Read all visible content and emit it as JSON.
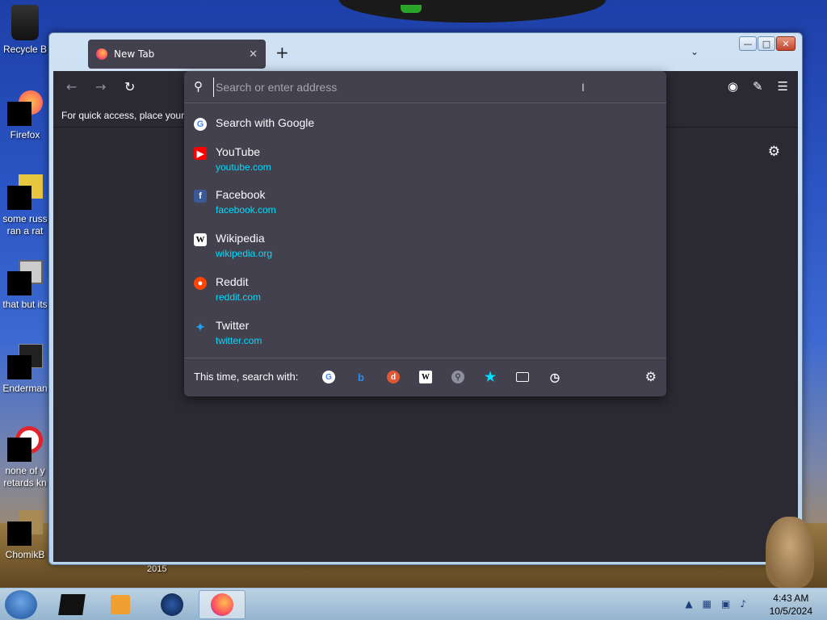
{
  "desktop": {
    "icons": [
      {
        "label": "Recycle B",
        "line2": ""
      },
      {
        "label": "Firefox",
        "line2": ""
      },
      {
        "label": "some russ",
        "line2": "ran a rat"
      },
      {
        "label": "that but its",
        "line2": ""
      },
      {
        "label": "Enderman",
        "line2": ""
      },
      {
        "label": "none of y",
        "line2": "retards kn"
      },
      {
        "label": "ChomikB",
        "line2": ""
      }
    ],
    "stray_text": "2015"
  },
  "browser": {
    "tab_title": "New Tab",
    "bookmarks_hint": "For quick access, place your b",
    "url_placeholder": "Search or enter address"
  },
  "suggestions": {
    "search_google": "Search with Google",
    "sites": [
      {
        "title": "YouTube",
        "url": "youtube.com",
        "icon": "youtube-icon",
        "color": "#ff0000"
      },
      {
        "title": "Facebook",
        "url": "facebook.com",
        "icon": "facebook-icon",
        "color": "#3b5998"
      },
      {
        "title": "Wikipedia",
        "url": "wikipedia.org",
        "icon": "wikipedia-icon",
        "color": "#ffffff"
      },
      {
        "title": "Reddit",
        "url": "reddit.com",
        "icon": "reddit-icon",
        "color": "#ff4500"
      },
      {
        "title": "Twitter",
        "url": "twitter.com",
        "icon": "twitter-icon",
        "color": "#1da1f2"
      }
    ],
    "search_with_label": "This time, search with:"
  },
  "taskbar": {
    "time": "4:43 AM",
    "date": "10/5/2024"
  },
  "colors": {
    "accent": "#00ddff",
    "panel": "#42414d",
    "chrome": "#2b2a33"
  }
}
